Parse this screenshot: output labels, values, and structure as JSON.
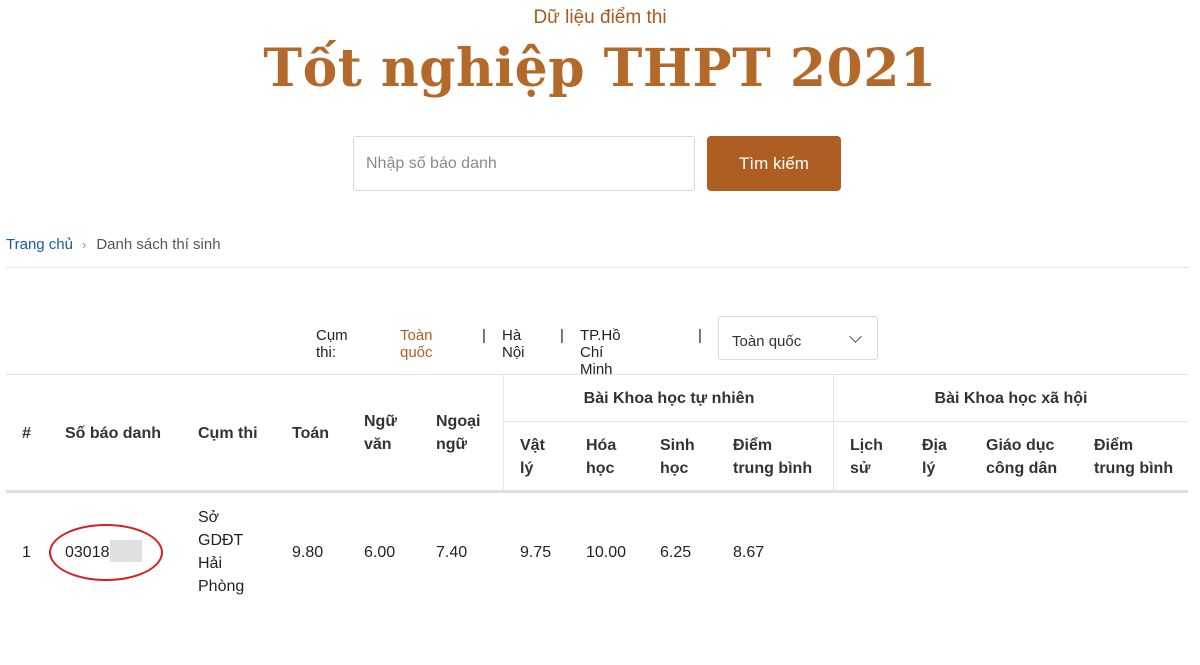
{
  "header": {
    "subtitle": "Dữ liệu điểm thi",
    "title": "Tốt nghiệp THPT 2021"
  },
  "search": {
    "placeholder": "Nhập số báo danh",
    "value": "",
    "button_label": "Tìm kiếm"
  },
  "breadcrumb": {
    "home": "Trang chủ",
    "current": "Danh sách thí sinh"
  },
  "filter": {
    "label": "Cụm thi:",
    "links": [
      "Toàn quốc",
      "Hà Nội",
      "TP.Hồ Chí Minh"
    ],
    "active": "Toàn quốc",
    "select_value": "Toàn quốc"
  },
  "table": {
    "headers": {
      "index": "#",
      "sbd": "Số báo danh",
      "cum_thi": "Cụm thi",
      "toan": "Toán",
      "ngu_van": [
        "Ngữ",
        "văn"
      ],
      "ngoai_ngu": [
        "Ngoại",
        "ngữ"
      ],
      "khtn_group": "Bài Khoa học tự nhiên",
      "vat_ly": [
        "Vật",
        "lý"
      ],
      "hoa_hoc": [
        "Hóa",
        "học"
      ],
      "sinh_hoc": [
        "Sinh",
        "học"
      ],
      "diem_tb_tn": [
        "Điểm",
        "trung bình"
      ],
      "khxh_group": "Bài Khoa học xã hội",
      "lich_su": [
        "Lịch",
        "sử"
      ],
      "dia_ly": [
        "Địa",
        "lý"
      ],
      "gdcd": [
        "Giáo dục",
        "công dân"
      ],
      "diem_tb_xh": [
        "Điểm",
        "trung bình"
      ]
    },
    "rows": [
      {
        "index": "1",
        "sbd": "03018",
        "cum_thi": [
          "Sở",
          "GDĐT",
          "Hải",
          "Phòng"
        ],
        "toan": "9.80",
        "ngu_van": "6.00",
        "ngoai_ngu": "7.40",
        "vat_ly": "9.75",
        "hoa_hoc": "10.00",
        "sinh_hoc": "6.25",
        "diem_tb_tn": "8.67",
        "lich_su": "",
        "dia_ly": "",
        "gdcd": "",
        "diem_tb_xh": ""
      }
    ]
  },
  "colors": {
    "brand": "#ae5e22",
    "title": "#b3692a",
    "link": "#1a5aa8",
    "highlight_circle": "#d42020"
  }
}
